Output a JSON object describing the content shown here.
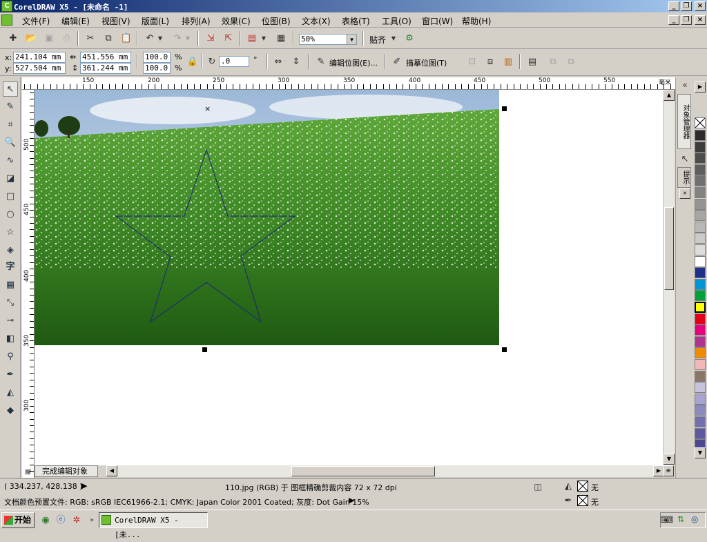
{
  "window": {
    "title": "CorelDRAW X5 - [未命名 -1]"
  },
  "menu": [
    "文件(F)",
    "编辑(E)",
    "视图(V)",
    "版面(L)",
    "排列(A)",
    "效果(C)",
    "位图(B)",
    "文本(X)",
    "表格(T)",
    "工具(O)",
    "窗口(W)",
    "帮助(H)"
  ],
  "toolbar": {
    "zoom": "50%",
    "snap_label": "贴齐"
  },
  "props": {
    "x": "241.104 mm",
    "y": "527.504 mm",
    "width": "451.556 mm",
    "height": "361.244 mm",
    "scale_x": "100.0",
    "scale_y": "100.0",
    "pct": "%",
    "rotation": ".0",
    "degree": "°",
    "edit_bitmap": "编辑位图(E)...",
    "trace_bitmap": "描摹位图(T)"
  },
  "ruler": {
    "h_labels": [
      "150",
      "200",
      "250",
      "300",
      "350",
      "400",
      "450",
      "500",
      "550"
    ],
    "h_unit": "毫米",
    "v_labels": [
      "500",
      "450",
      "400",
      "350",
      "300"
    ],
    "v_unit": "毫米"
  },
  "canvas": {
    "finish_edit": "完成编辑对象"
  },
  "docker": {
    "tab1": "对象管理器",
    "tab2": "提示"
  },
  "status": {
    "coords": "( 334.237, 428.138 )",
    "object_info": "110.jpg (RGB) 于 图框精确剪裁内容 72 x 72 dpi",
    "fill_none": "无",
    "outline_none": "无",
    "color_profile": "文档颜色预置文件: RGB: sRGB IEC61966-2.1; CMYK: Japan Color 2001 Coated; 灰度: Dot Gain 15%"
  },
  "taskbar": {
    "start": "开始",
    "task_label": "CorelDRAW X5 - [未..."
  },
  "palette": [
    "#ffffff",
    "#2b2b2b",
    "#3c3c3c",
    "#4d4d4d",
    "#5e5e5e",
    "#707070",
    "#828282",
    "#949494",
    "#a6a6a6",
    "#b8b8b8",
    "#cacaca",
    "#dcdcdc",
    "#ffffff",
    "#1d2f8a",
    "#0096d6",
    "#00a03c",
    "#ffff00",
    "#e3001b",
    "#e6007e",
    "#b0338f",
    "#f08c00",
    "#f2b8b8",
    "#8b7565",
    "#c6c3e0",
    "#a8a4d0",
    "#8c88c0",
    "#7470b0",
    "#5e58a0",
    "#4d4890"
  ]
}
